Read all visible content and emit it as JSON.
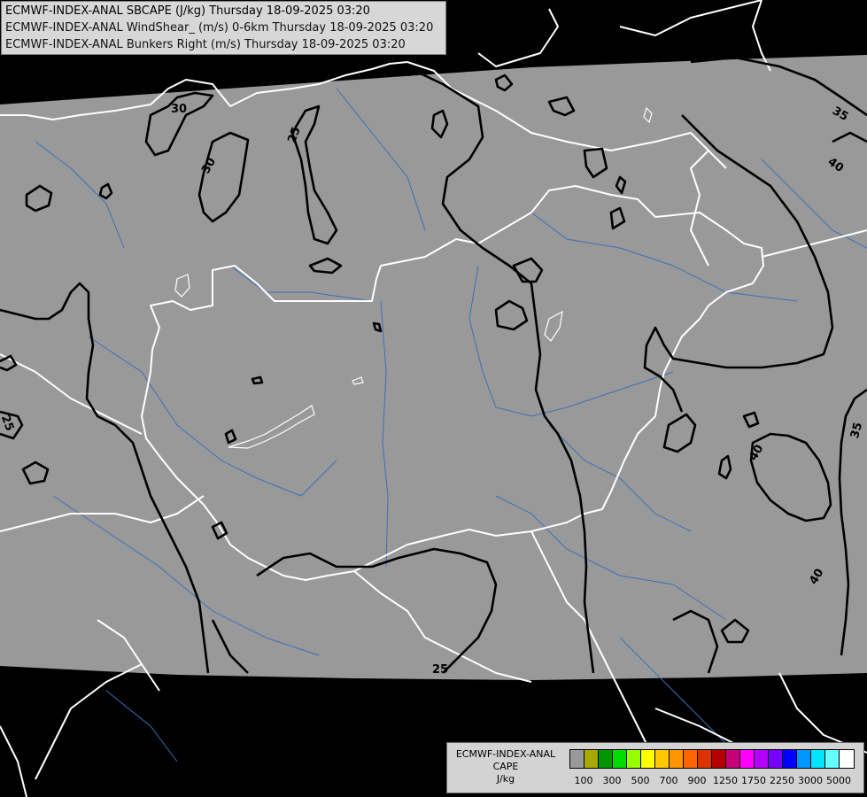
{
  "header": {
    "lines": [
      "ECMWF-INDEX-ANAL SBCAPE (J/kg) Thursday 18-09-2025 03:20",
      "ECMWF-INDEX-ANAL WindShear_ (m/s) 0-6km Thursday 18-09-2025 03:20",
      "ECMWF-INDEX-ANAL Bunkers Right (m/s) Thursday 18-09-2025 03:20"
    ]
  },
  "map": {
    "colors": {
      "background": "#000000",
      "domain": "#999999",
      "border": "#ffffff",
      "river": "#3b6fb8",
      "contour": "#000000"
    },
    "contour_labels": [
      "30",
      "30",
      "30",
      "25",
      "35",
      "40",
      "25",
      "35",
      "40",
      "40",
      "25"
    ]
  },
  "legend": {
    "title": [
      "ECMWF-INDEX-ANAL",
      "CAPE",
      "J/kg"
    ],
    "colors": [
      "#999999",
      "#a8a800",
      "#009600",
      "#00dc00",
      "#96ff00",
      "#ffff00",
      "#ffc800",
      "#ff9600",
      "#ff6400",
      "#dc3200",
      "#b40000",
      "#c80078",
      "#ff00ff",
      "#b400ff",
      "#7800ff",
      "#0000ff",
      "#0096ff",
      "#00e6ff",
      "#64ffff",
      "#ffffff"
    ],
    "labels": [
      "100",
      "300",
      "500",
      "700",
      "900",
      "1250",
      "1750",
      "2250",
      "3000",
      "5000"
    ]
  }
}
